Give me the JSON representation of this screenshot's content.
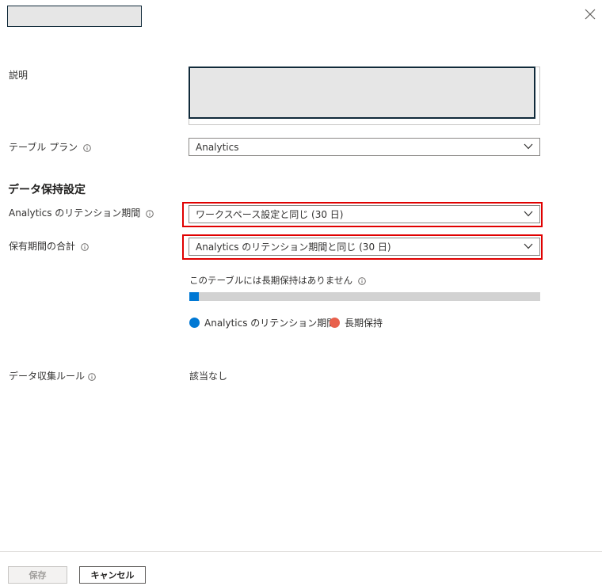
{
  "panel": {
    "title": ""
  },
  "fields": {
    "description": {
      "label": "説明",
      "value": ""
    },
    "table_plan": {
      "label": "テーブル プラン",
      "value": "Analytics"
    }
  },
  "retention": {
    "heading": "データ保持設定",
    "analytics_retention": {
      "label": "Analytics のリテンション期間",
      "value": "ワークスペース設定と同じ (30 日)"
    },
    "total_retention": {
      "label": "保有期間の合計",
      "value": "Analytics のリテンション期間と同じ (30 日)"
    },
    "longterm_note": "このテーブルには長期保持はありません",
    "bar": {
      "analytics_fraction": 0.027
    },
    "legend": {
      "analytics": "Analytics のリテンション期間",
      "longterm": "長期保持"
    }
  },
  "collection_rule": {
    "label": "データ収集ルール",
    "value": "該当なし"
  },
  "buttons": {
    "save": "保存",
    "cancel": "キャンセル"
  },
  "colors": {
    "analytics": "#0078d4",
    "longterm": "#e8604c",
    "highlight": "#e00000"
  },
  "icons": {
    "close": "close-icon",
    "info": "info-icon",
    "chevron": "chevron-down-icon"
  }
}
